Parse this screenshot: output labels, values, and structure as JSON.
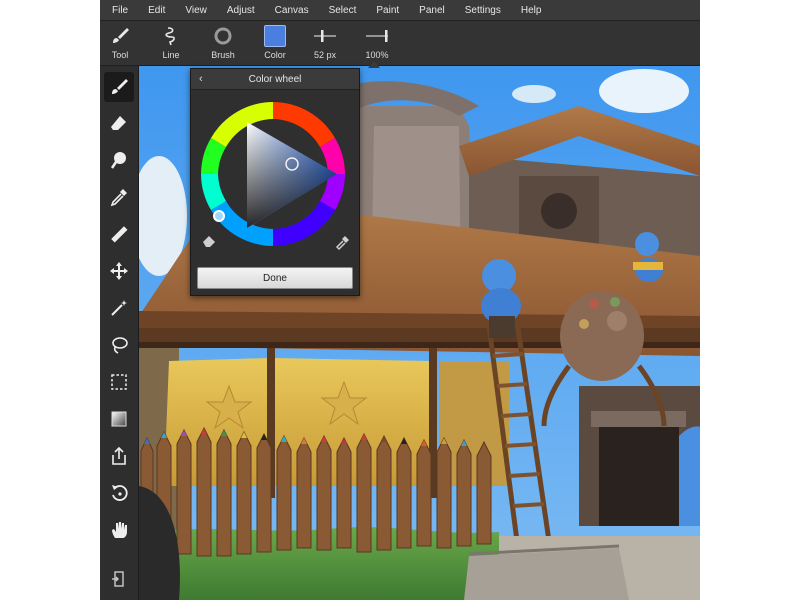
{
  "menu": [
    "File",
    "Edit",
    "View",
    "Adjust",
    "Canvas",
    "Select",
    "Paint",
    "Panel",
    "Settings",
    "Help"
  ],
  "toolbar": {
    "tool_label": "Tool",
    "line_label": "Line",
    "brush_label": "Brush",
    "color_label": "Color",
    "size_label": "52 px",
    "opacity_label": "100%",
    "current_color": "#4a7fe0"
  },
  "rail_icons": [
    "brush-icon",
    "eraser-icon",
    "smudge-icon",
    "eyedropper-icon",
    "ruler-icon",
    "move-icon",
    "magic-wand-icon",
    "lasso-icon",
    "marquee-icon",
    "gradient-icon",
    "export-icon",
    "undo-icon",
    "hand-icon",
    "exit-icon"
  ],
  "color_wheel": {
    "title": "Color wheel",
    "back_glyph": "‹",
    "done_label": "Done",
    "selected_hue_color": "#2f6fe8"
  }
}
